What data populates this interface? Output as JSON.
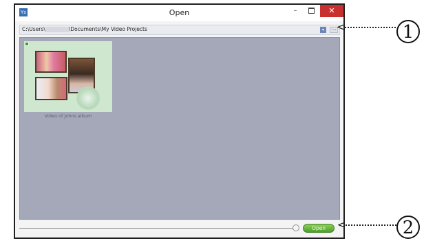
{
  "window": {
    "title": "Open",
    "app_icon_label": "Ys",
    "minimize_label": "–",
    "close_label": "✕"
  },
  "pathbar": {
    "path_prefix": "C:\\Users\\",
    "path_suffix": "\\Documents\\My Video Projects",
    "dropdown_label": "▾",
    "more_label": "..."
  },
  "items": [
    {
      "label": "Video of Johns album"
    }
  ],
  "footer": {
    "open_label": "Open"
  },
  "annotations": {
    "callout_1": "1",
    "callout_2": "2"
  }
}
